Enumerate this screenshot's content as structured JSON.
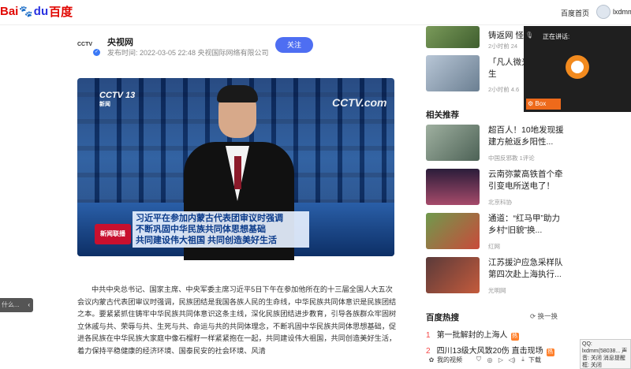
{
  "topbar": {
    "logo_bai": "Bai",
    "logo_du": "du",
    "logo_cn": "百度",
    "home_link": "百度首页",
    "username": "lxdmm"
  },
  "article": {
    "author": "央视网",
    "author_logo": "CCTV",
    "meta": "发布时间: 2022-03-05 22:48 央视国际网络有限公司",
    "follow": "关注",
    "video": {
      "channel": "CCTV 13",
      "channel_sub": "新闻",
      "watermark": "CCTV.com",
      "program": "新闻联播",
      "caption_lines": [
        "习近平在参加内蒙古代表团审议时强调",
        "不断巩固中华民族共同体思想基础",
        "共同建设伟大祖国 共同创造美好生活"
      ]
    },
    "body": "中共中央总书记、国家主席、中央军委主席习近平5日下午在参加他所在的十三届全国人大五次会议内蒙古代表团审议时强调，民族团结是我国各族人民的生命线，中华民族共同体意识是民族团结之本。要紧紧抓住铸牢中华民族共同体意识这条主线，深化民族团结进步教育，引导各族群众牢固树立休戚与共、荣辱与共、生死与共、命运与共的共同体理念，不断巩固中华民族共同体思想基础，促进各民族在中华民族大家庭中像石榴籽一样紧紧抱在一起，共同建设伟大祖国，共同创造美好生活，着力保持平稳健康的经济环境、国泰民安的社会环境、风清"
  },
  "left_hint": "什么...",
  "sidebar": {
    "top_items": [
      {
        "title": "铸返网 怪满",
        "meta": "2小时前 24"
      },
      {
        "title": "「凡人微光 委坚守一生",
        "meta": "2小时前 4.6"
      }
    ],
    "related_title": "相关推荐",
    "related": [
      {
        "title": "超百人！10地发现援建方舱返乡阳性...",
        "meta": "中国反邪教 1评论"
      },
      {
        "title": "云南弥蒙高铁首个牵引变电所送电了！",
        "meta": "北京科协"
      },
      {
        "title": "通道：“红马甲”助力乡村“旧貌”换...",
        "meta": "红网"
      },
      {
        "title": "江苏援沪应急采样队第四次赴上海执行...",
        "meta": "光明网"
      }
    ],
    "hot_title": "百度热搜",
    "refresh": "换一换",
    "hot": [
      {
        "num": "1",
        "text": "第一批解封的上海人",
        "badge": "热"
      },
      {
        "num": "2",
        "text": "四川13级大风致20伤 直击现场",
        "badge": "热"
      }
    ]
  },
  "speaking": {
    "label": "正在讲话:",
    "box": "Box"
  },
  "bottom_bar": {
    "video": "我的视频",
    "download": "下载"
  },
  "qq_tip": "QQ: lxdmm(58038... 声音: 关闭 消息提醒框: 关闭"
}
